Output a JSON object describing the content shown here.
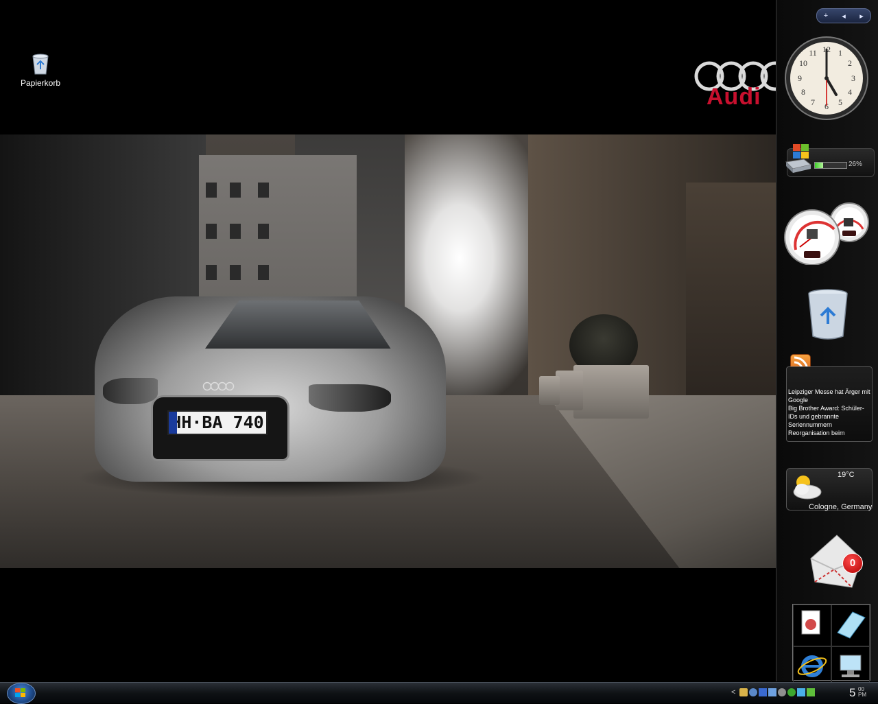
{
  "desktop": {
    "icons": [
      {
        "label": "Papierkorb",
        "icon": "recycle-bin-icon"
      }
    ]
  },
  "wallpaper": {
    "brand": "Audi",
    "plate": "HH·BA 740"
  },
  "sidebar": {
    "controls": [
      "+",
      "◂",
      "▸"
    ],
    "clock": {
      "hour": 5,
      "minute": 0
    },
    "cpu": {
      "percent_text": "26%",
      "percent": 0.26
    },
    "rss": {
      "items": [
        "Leipziger Messe hat Ärger mit Google",
        "Big Brother Award: Schüler-IDs und gebrannte Seriennummern",
        "Reorganisation beim"
      ]
    },
    "weather": {
      "temp": "19°C",
      "city": "Cologne, Germany"
    },
    "mail": {
      "count": "0"
    }
  },
  "taskbar": {
    "time_hour": "5",
    "time_min": "00",
    "time_ampm": "PM",
    "tray_chevron": "<"
  },
  "colors": {
    "audi_red": "#c8102e",
    "accent_blue": "#1f4d8e"
  }
}
